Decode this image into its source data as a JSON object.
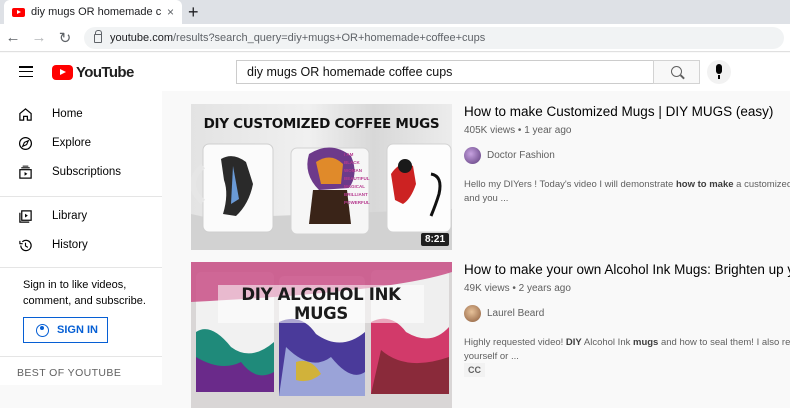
{
  "browser": {
    "tab_title": "diy mugs OR homemade coffee cups - YouTube",
    "new_tab": "+",
    "close_tab": "×",
    "url_host": "youtube.com",
    "url_path": "/results?search_query=diy+mugs+OR+homemade+coffee+cups"
  },
  "masthead": {
    "logo_text": "YouTube",
    "search_value": "diy mugs OR homemade coffee cups"
  },
  "sidebar": {
    "items": [
      {
        "label": "Home",
        "icon": "home-icon"
      },
      {
        "label": "Explore",
        "icon": "compass-icon"
      },
      {
        "label": "Subscriptions",
        "icon": "subscriptions-icon"
      },
      {
        "label": "Library",
        "icon": "library-icon"
      },
      {
        "label": "History",
        "icon": "history-icon"
      }
    ],
    "signin_text": "Sign in to like videos, comment, and subscribe.",
    "signin_button": "SIGN IN",
    "section_title": "BEST OF YOUTUBE"
  },
  "results": [
    {
      "thumb_title": "DIY CUSTOMIZED COFFEE MUGS",
      "duration": "8:21",
      "title": "How to make Customized Mugs | DIY MUGS (easy)",
      "meta": "405K views • 1 year ago",
      "channel": "Doctor Fashion",
      "desc_pre": "Hello my DIYers ! Today's video I will demonstrate ",
      "desc_bold": "how to make",
      "desc_post": " a customized cof",
      "desc_line2": "and you ..."
    },
    {
      "thumb_title": "DIY ALCOHOL INK MUGS",
      "title": "How to make your own Alcohol Ink Mugs: Brighten up you",
      "meta": "49K views • 2 years ago",
      "channel": "Laurel Beard",
      "desc_pre": "Highly requested video! ",
      "desc_bold": "DIY",
      "desc_mid": " Alcohol Ink ",
      "desc_bold2": "mugs",
      "desc_post": " and how to seal them! I also recom",
      "desc_line2": "yourself or ...",
      "badge": "CC"
    }
  ]
}
